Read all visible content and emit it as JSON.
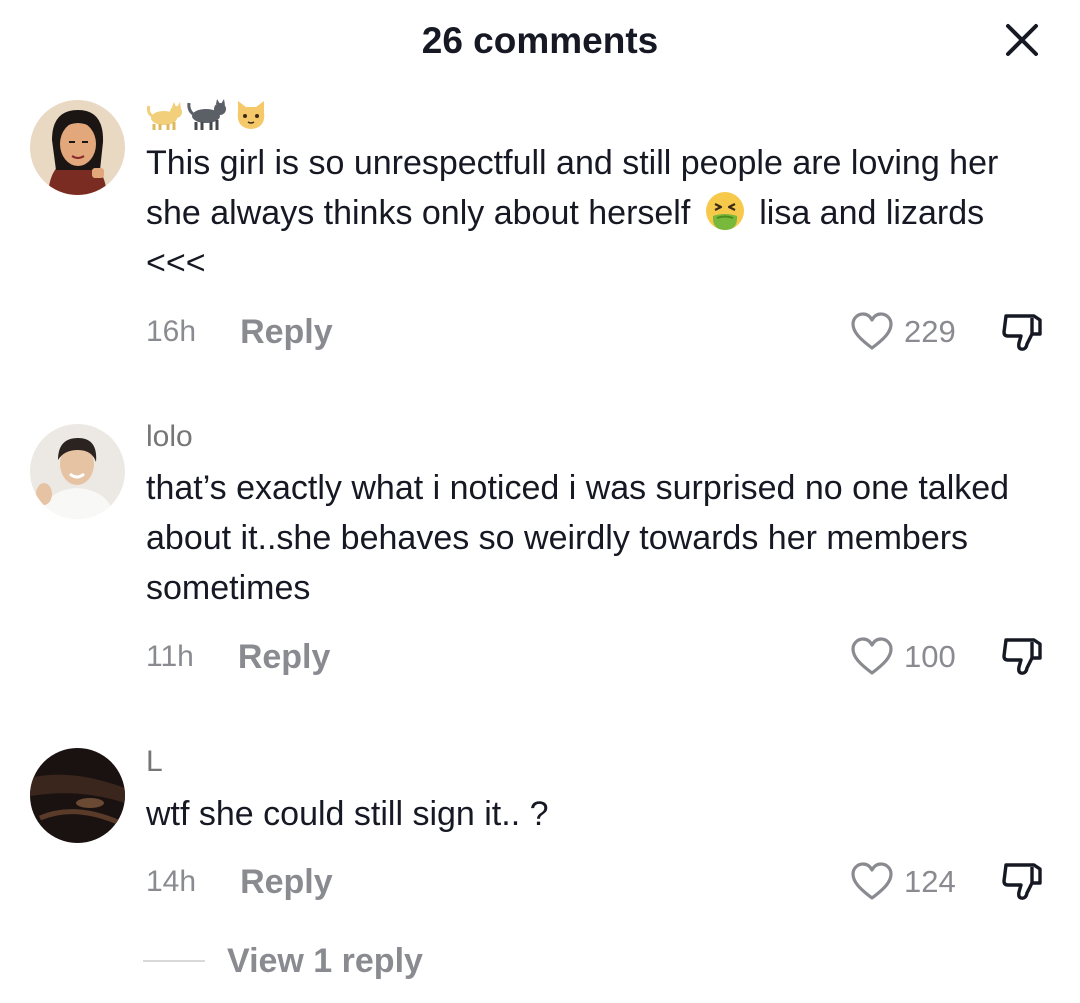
{
  "header": {
    "title": "26 comments",
    "close_icon": "close-x-icon"
  },
  "comments": [
    {
      "username_icons": [
        "cat-emoji",
        "black-cat-emoji",
        "cat-face-emoji"
      ],
      "text_before_emoji": "This girl is so unrespectfull and still people are loving her she always thinks only about herself",
      "inline_emoji": "nauseated-face-emoji",
      "text_after_emoji": "lisa and lizards <<<",
      "time": "16h",
      "reply_label": "Reply",
      "likes": "229"
    },
    {
      "username": "lolo",
      "text": "that’s exactly what i noticed i was surprised no one talked about it..she behaves so weirdly towards her members sometimes",
      "time": "11h",
      "reply_label": "Reply",
      "likes": "100"
    },
    {
      "username": "L",
      "text": "wtf she could still sign it.. ?",
      "time": "14h",
      "reply_label": "Reply",
      "likes": "124",
      "view_replies_label": "View 1 reply"
    }
  ],
  "colors": {
    "text_primary": "#161823",
    "text_secondary": "#8a8b91",
    "background": "#ffffff"
  }
}
